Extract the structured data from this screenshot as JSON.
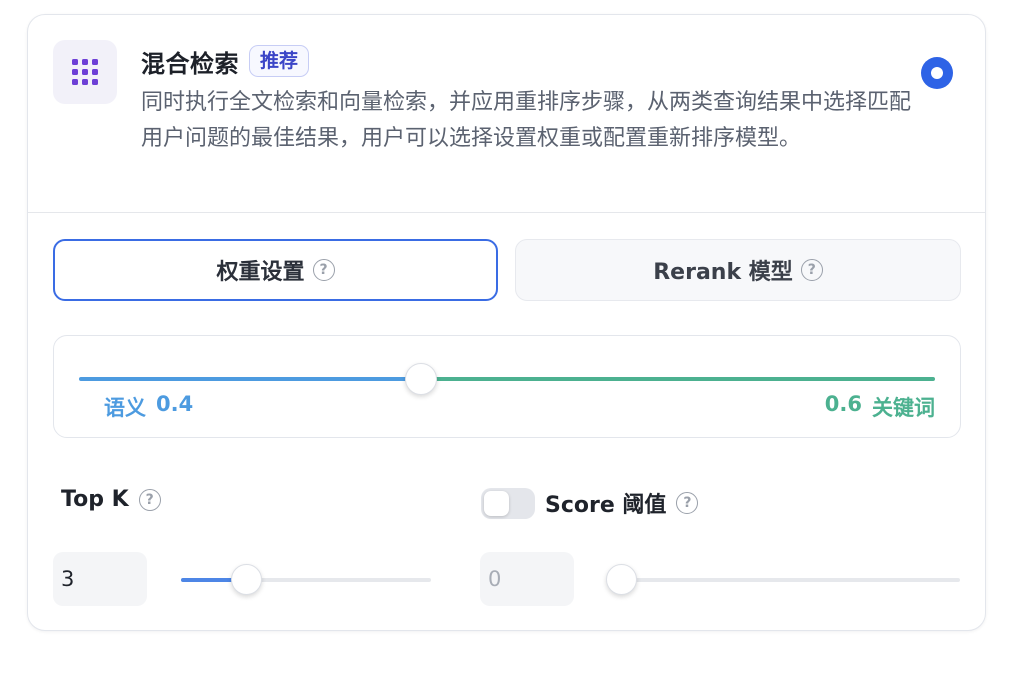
{
  "mode": {
    "title": "混合检索",
    "badge": "推荐",
    "description": "同时执行全文检索和向量检索，并应用重排序步骤，从两类查询结果中选择匹配用户问题的最佳结果，用户可以选择设置权重或配置重新排序模型。",
    "selected": true,
    "icon": "grid-dots-icon",
    "icon_color": "#6d3fd6"
  },
  "tabs": [
    {
      "label": "权重设置",
      "active": true
    },
    {
      "label": "Rerank 模型",
      "active": false
    }
  ],
  "weights": {
    "semantic_label": "语义",
    "semantic_value": "0.4",
    "keyword_label": "关键词",
    "keyword_value": "0.6",
    "semantic_fraction": 0.4,
    "semantic_color": "#4d9be0",
    "keyword_color": "#4cb190"
  },
  "top_k": {
    "label": "Top K",
    "value": "3",
    "slider_fraction": 0.26
  },
  "score_threshold": {
    "label": "Score 阈值",
    "enabled": false,
    "value": "0",
    "slider_fraction": 0.0
  },
  "colors": {
    "accent": "#2e63e6",
    "active_tab_border": "#3a6ce4"
  }
}
